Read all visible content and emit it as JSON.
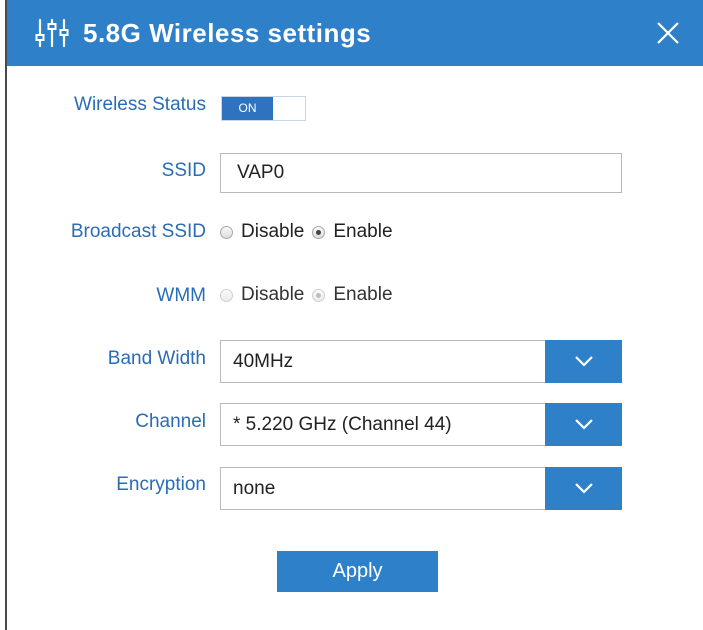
{
  "dialog": {
    "title": "5.8G Wireless settings",
    "accent_color": "#2e80c9",
    "title_icon": "sliders-icon",
    "close_icon": "close-icon"
  },
  "fields": {
    "wireless_status": {
      "label": "Wireless Status",
      "toggle_text": "ON",
      "state": "on"
    },
    "ssid": {
      "label": "SSID",
      "value": "VAP0"
    },
    "broadcast_ssid": {
      "label": "Broadcast SSID",
      "options": [
        "Disable",
        "Enable"
      ],
      "selected": "Enable"
    },
    "wmm": {
      "label": "WMM",
      "options": [
        "Disable",
        "Enable"
      ],
      "selected": "Enable",
      "disabled": true
    },
    "band_width": {
      "label": "Band Width",
      "value": "40MHz"
    },
    "channel": {
      "label": "Channel",
      "value": "* 5.220 GHz (Channel 44)"
    },
    "encryption": {
      "label": "Encryption",
      "value": "none"
    }
  },
  "apply_label": "Apply"
}
